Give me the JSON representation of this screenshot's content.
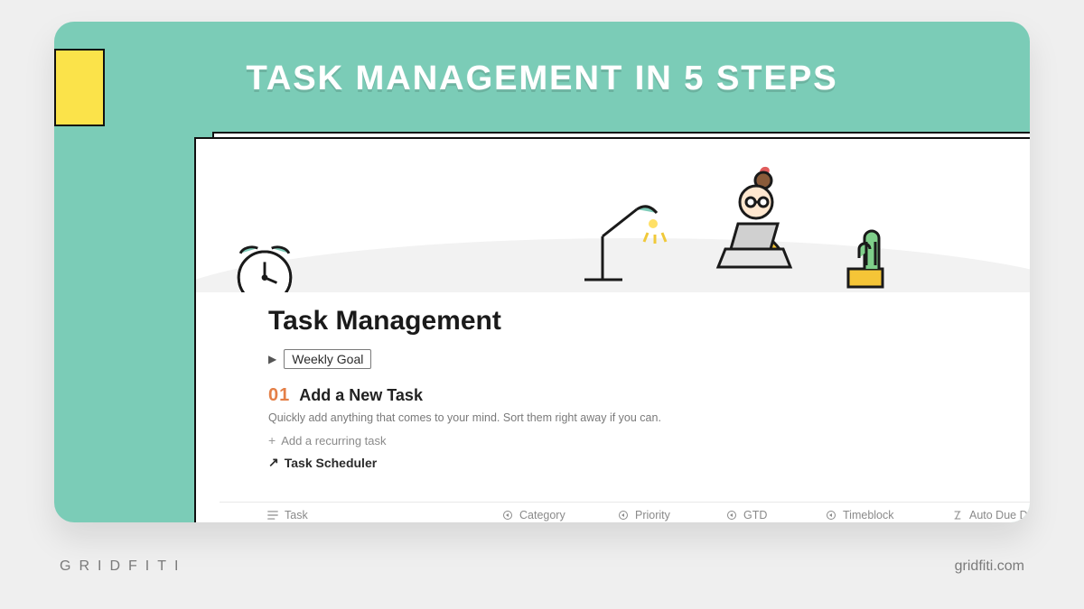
{
  "headline": "TASK MANAGEMENT IN 5 STEPS",
  "colors": {
    "bg": "#7bccb7",
    "accent_yellow": "#fbe34a",
    "step_num": "#e47f47"
  },
  "notion": {
    "title": "Task Management",
    "toggle_label": "Weekly Goal",
    "step": {
      "num": "01",
      "title": "Add a New Task"
    },
    "step_desc": "Quickly add anything that comes to your mind. Sort them right away if you can.",
    "add_recurring": "Add a recurring task",
    "task_scheduler": "Task Scheduler",
    "columns": {
      "task": "Task",
      "category": "Category",
      "priority": "Priority",
      "gtd": "GTD",
      "timeblock": "Timeblock",
      "auto_due": "Auto Due Date"
    }
  },
  "footer": {
    "brand": "GRIDFITI",
    "url": "gridfiti.com"
  }
}
